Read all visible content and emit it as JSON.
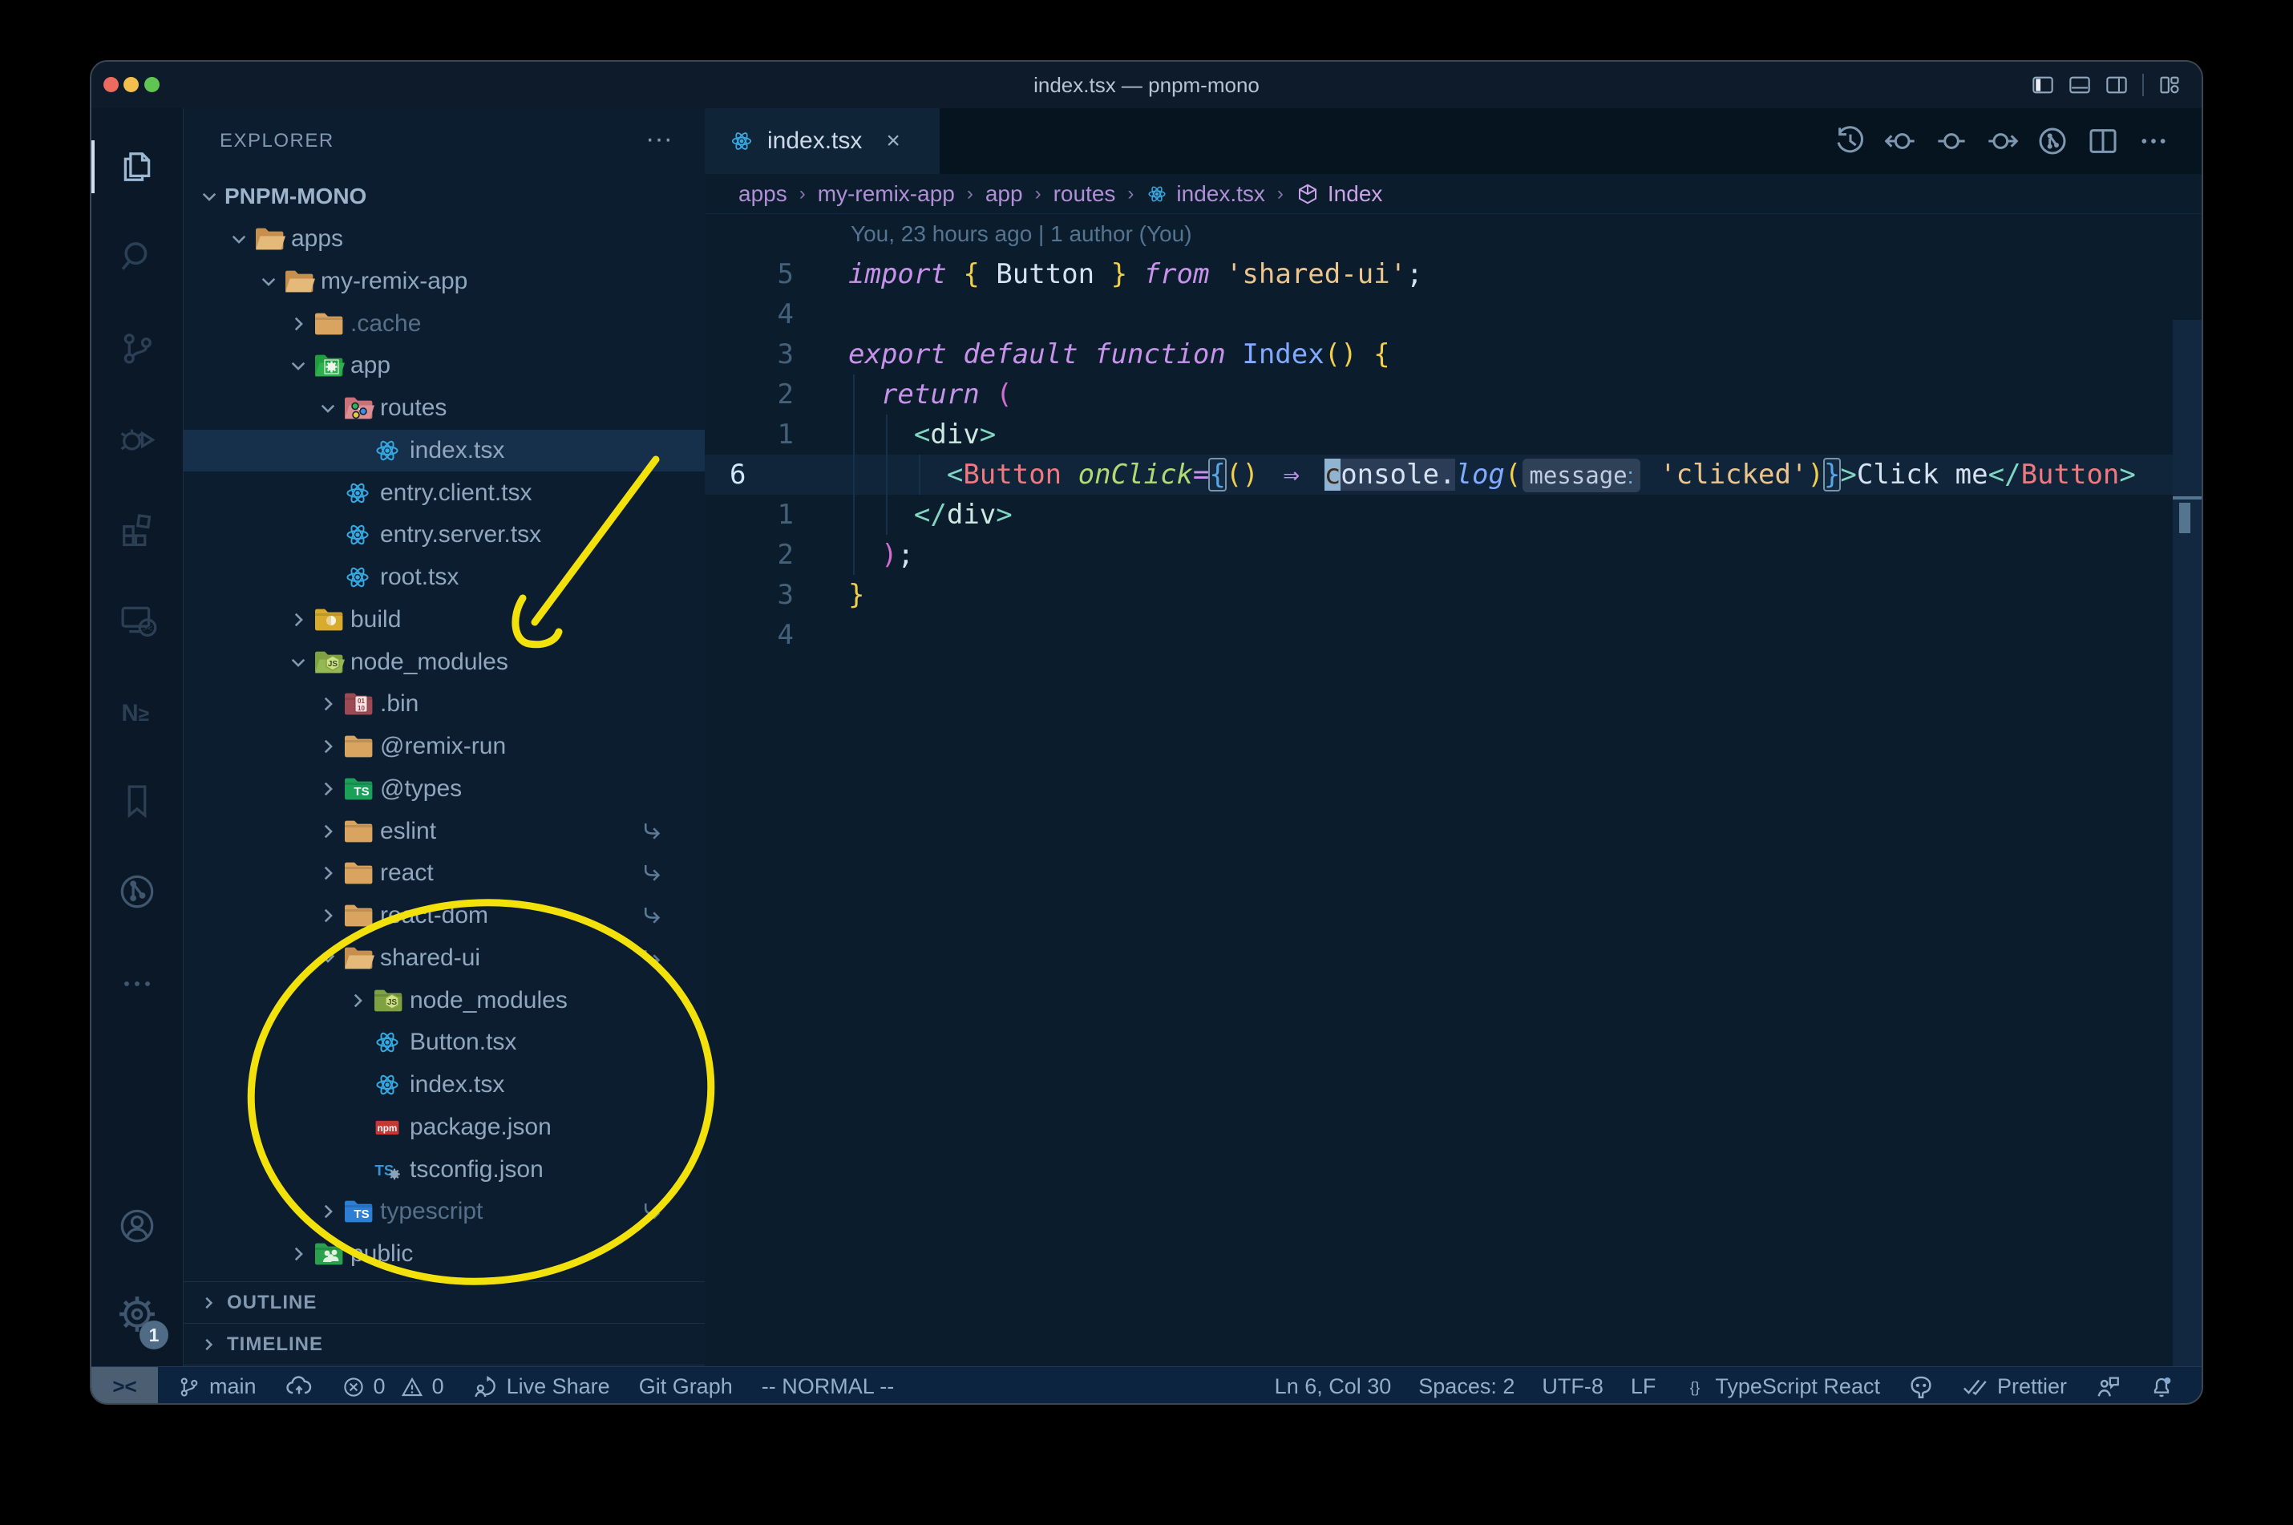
{
  "window": {
    "title": "index.tsx — pnpm-mono"
  },
  "palette": {
    "titlebar": "#0d1b2b",
    "activity": "#0a1827",
    "sidebar": "#0c1d2f",
    "editor": "#0b1c2d",
    "tabbar": "#061420",
    "tabactive": "#0f2436",
    "selrow": "#16304b",
    "curline": "#10253a",
    "status": "#0d2440",
    "statustext": "#93aec9",
    "remotebox": "#4b5e72",
    "treetext": "#91a7bd",
    "lineno": "#45617a",
    "linenocur": "#cfe8ff",
    "blame": "#54748f",
    "bctext": "#b08fd6",
    "kw": "#c792ea",
    "str": "#ecc48d",
    "gold": "#f2ce4b",
    "pink": "#d16dd1",
    "bblue": "#58a6e8",
    "id": "#d6e2f2",
    "fn": "#82aaff",
    "tagp": "#7fd6c2",
    "tag": "#cde9df",
    "comp": "#f0797f",
    "attr": "#b2d974",
    "inlaybg": "#2e4157",
    "inlaytx": "#c0cde0",
    "occ": "#2b3d56",
    "cursorbg": "#8fb3d1",
    "cursortx": "#3a2b1a",
    "traffic_red": "#ed6a5e",
    "traffic_yellow": "#f4be4f",
    "traffic_green": "#61c554",
    "react_blue": "#35a9e1",
    "annotation_yellow": "#f3e10c"
  },
  "titlebar": {
    "layout_icons": [
      "toggle-sidebar",
      "toggle-panel",
      "toggle-secondary-sidebar",
      "customize-layout"
    ]
  },
  "activity_bar": {
    "items": [
      {
        "icon": "files",
        "active": true
      },
      {
        "icon": "search"
      },
      {
        "icon": "source-control"
      },
      {
        "icon": "run-debug"
      },
      {
        "icon": "extensions"
      },
      {
        "icon": "remote-explorer"
      },
      {
        "icon": "nx-console"
      },
      {
        "icon": "bookmarks"
      },
      {
        "icon": "git-graph"
      },
      {
        "icon": "more"
      }
    ],
    "bottom": [
      {
        "icon": "account"
      },
      {
        "icon": "settings-gear",
        "badge": "1"
      }
    ]
  },
  "sidebar": {
    "header": "EXPLORER",
    "tree": [
      {
        "label": "PNPM-MONO",
        "level": 0,
        "chevron": "open",
        "icon": null,
        "root": true
      },
      {
        "label": "apps",
        "level": 1,
        "chevron": "open",
        "icon": "folder-tan-open"
      },
      {
        "label": "my-remix-app",
        "level": 2,
        "chevron": "open",
        "icon": "folder-tan-open"
      },
      {
        "label": ".cache",
        "level": 3,
        "chevron": "closed",
        "icon": "folder-tan",
        "dim": true
      },
      {
        "label": "app",
        "level": 3,
        "chevron": "open",
        "icon": "folder-app-open"
      },
      {
        "label": "routes",
        "level": 4,
        "chevron": "open",
        "icon": "folder-routes-open"
      },
      {
        "label": "index.tsx",
        "level": 5,
        "chevron": "none",
        "icon": "react",
        "selected": true
      },
      {
        "label": "entry.client.tsx",
        "level": 4,
        "chevron": "none",
        "icon": "react"
      },
      {
        "label": "entry.server.tsx",
        "level": 4,
        "chevron": "none",
        "icon": "react"
      },
      {
        "label": "root.tsx",
        "level": 4,
        "chevron": "none",
        "icon": "react"
      },
      {
        "label": "build",
        "level": 3,
        "chevron": "closed",
        "icon": "folder-build"
      },
      {
        "label": "node_modules",
        "level": 3,
        "chevron": "open",
        "icon": "folder-node-open"
      },
      {
        "label": ".bin",
        "level": 4,
        "chevron": "closed",
        "icon": "folder-bin"
      },
      {
        "label": "@remix-run",
        "level": 4,
        "chevron": "closed",
        "icon": "folder-tan"
      },
      {
        "label": "@types",
        "level": 4,
        "chevron": "closed",
        "icon": "folder-types"
      },
      {
        "label": "eslint",
        "level": 4,
        "chevron": "closed",
        "icon": "folder-tan",
        "symlink": true
      },
      {
        "label": "react",
        "level": 4,
        "chevron": "closed",
        "icon": "folder-tan",
        "symlink": true
      },
      {
        "label": "react-dom",
        "level": 4,
        "chevron": "closed",
        "icon": "folder-tan",
        "symlink": true
      },
      {
        "label": "shared-ui",
        "level": 4,
        "chevron": "open",
        "icon": "folder-tan-open",
        "symlink": true
      },
      {
        "label": "node_modules",
        "level": 5,
        "chevron": "closed",
        "icon": "folder-node"
      },
      {
        "label": "Button.tsx",
        "level": 5,
        "chevron": "none",
        "icon": "react"
      },
      {
        "label": "index.tsx",
        "level": 5,
        "chevron": "none",
        "icon": "react"
      },
      {
        "label": "package.json",
        "level": 5,
        "chevron": "none",
        "icon": "npm"
      },
      {
        "label": "tsconfig.json",
        "level": 5,
        "chevron": "none",
        "icon": "tsconfig"
      },
      {
        "label": "typescript",
        "level": 4,
        "chevron": "closed",
        "icon": "folder-ts",
        "dim": true,
        "symlink": true
      },
      {
        "label": "public",
        "level": 3,
        "chevron": "closed",
        "icon": "folder-public"
      }
    ],
    "sections": [
      "OUTLINE",
      "TIMELINE"
    ]
  },
  "editor": {
    "tab": {
      "label": "index.tsx",
      "icon": "react",
      "close": "×"
    },
    "actions": [
      "timeline",
      "step-back",
      "circle",
      "step-forward",
      "run-graph",
      "split-editor",
      "more-actions"
    ],
    "breadcrumbs": [
      {
        "label": "apps"
      },
      {
        "label": "my-remix-app"
      },
      {
        "label": "app"
      },
      {
        "label": "routes"
      },
      {
        "label": "index.tsx",
        "icon": "react"
      },
      {
        "label": "Index",
        "icon": "symbol-class"
      }
    ],
    "blame": "You, 23 hours ago | 1 author (You)",
    "lines": [
      {
        "gutter": "5",
        "tokens": [
          [
            "kw",
            "import"
          ],
          [
            "sp",
            " "
          ],
          [
            "b1",
            "{"
          ],
          [
            "sp",
            " "
          ],
          [
            "id",
            "Button"
          ],
          [
            "sp",
            " "
          ],
          [
            "b1",
            "}"
          ],
          [
            "sp",
            " "
          ],
          [
            "kw",
            "from"
          ],
          [
            "sp",
            " "
          ],
          [
            "str",
            "'shared-ui'"
          ],
          [
            "id",
            ";"
          ]
        ]
      },
      {
        "gutter": "4",
        "tokens": []
      },
      {
        "gutter": "3",
        "tokens": [
          [
            "kw",
            "export"
          ],
          [
            "sp",
            " "
          ],
          [
            "kw",
            "default"
          ],
          [
            "sp",
            " "
          ],
          [
            "kw",
            "function"
          ],
          [
            "sp",
            " "
          ],
          [
            "fn",
            "Index"
          ],
          [
            "b1",
            "()"
          ],
          [
            "sp",
            " "
          ],
          [
            "b1",
            "{"
          ]
        ]
      },
      {
        "gutter": "2",
        "tokens": [
          [
            "sp",
            "  "
          ],
          [
            "kw",
            "return"
          ],
          [
            "sp",
            " "
          ],
          [
            "b2",
            "("
          ]
        ]
      },
      {
        "gutter": "1",
        "tokens": [
          [
            "sp",
            "    "
          ],
          [
            "tagp",
            "<"
          ],
          [
            "tag",
            "div"
          ],
          [
            "tagp",
            ">"
          ]
        ]
      },
      {
        "gutter": "6",
        "current": true,
        "tokens": [
          [
            "sp",
            "      "
          ],
          [
            "tagp",
            "<"
          ],
          [
            "comp",
            "Button"
          ],
          [
            "sp",
            " "
          ],
          [
            "attr",
            "onClick"
          ],
          [
            "op",
            "="
          ],
          [
            "b3",
            "{",
            "bracket"
          ],
          [
            "b1",
            "()"
          ],
          [
            "sp",
            " "
          ],
          [
            "arrow",
            "⇒"
          ],
          [
            "sp",
            " "
          ],
          [
            "id",
            "c",
            "cursor"
          ],
          [
            "id",
            "onsole.",
            "occ"
          ],
          [
            "method",
            "log"
          ],
          [
            "b1",
            "("
          ],
          [
            "inlay",
            "message:"
          ],
          [
            "sp",
            " "
          ],
          [
            "str",
            "'clicked'"
          ],
          [
            "b1",
            ")"
          ],
          [
            "b3",
            "}",
            "bracket"
          ],
          [
            "tagp",
            ">"
          ],
          [
            "id",
            "Click me"
          ],
          [
            "tagp",
            "</"
          ],
          [
            "comp",
            "Button"
          ],
          [
            "tagp",
            ">"
          ]
        ]
      },
      {
        "gutter": "1",
        "tokens": [
          [
            "sp",
            "    "
          ],
          [
            "tagp",
            "</"
          ],
          [
            "tag",
            "div"
          ],
          [
            "tagp",
            ">"
          ]
        ]
      },
      {
        "gutter": "2",
        "tokens": [
          [
            "sp",
            "  "
          ],
          [
            "b2",
            ")"
          ],
          [
            "id",
            ";"
          ]
        ]
      },
      {
        "gutter": "3",
        "tokens": [
          [
            "b1",
            "}"
          ]
        ]
      },
      {
        "gutter": "4",
        "tokens": []
      }
    ]
  },
  "status_bar": {
    "left": [
      {
        "icon": "remote",
        "label": "",
        "name": "remote-indicator"
      },
      {
        "icon": "git-branch",
        "label": "main",
        "name": "branch"
      },
      {
        "icon": "sync-cloud",
        "label": "",
        "name": "sync"
      },
      {
        "icon": "errors-warnings",
        "label": "0|0",
        "name": "problems",
        "errors": "0",
        "warnings": "0"
      },
      {
        "icon": "live-share",
        "label": "Live Share",
        "name": "live-share"
      },
      {
        "icon": null,
        "label": "Git Graph",
        "name": "git-graph"
      },
      {
        "icon": null,
        "label": "-- NORMAL --",
        "name": "vim-mode"
      }
    ],
    "right": [
      {
        "label": "Ln 6, Col 30",
        "name": "cursor-position"
      },
      {
        "label": "Spaces: 2",
        "name": "indentation"
      },
      {
        "label": "UTF-8",
        "name": "encoding"
      },
      {
        "label": "LF",
        "name": "eol"
      },
      {
        "icon": "braces",
        "label": "TypeScript React",
        "name": "language"
      },
      {
        "icon": "octoface",
        "label": "",
        "name": "github"
      },
      {
        "icon": "double-check",
        "label": "Prettier",
        "name": "prettier"
      },
      {
        "icon": "feedback",
        "label": "",
        "name": "feedback"
      },
      {
        "icon": "bell-dot",
        "label": "",
        "name": "notifications"
      }
    ]
  },
  "annotations": {
    "color": "#f3e10c",
    "items": [
      "hand-drawn-arrow-to-node-modules",
      "hand-drawn-ellipse-around-shared-ui"
    ]
  }
}
